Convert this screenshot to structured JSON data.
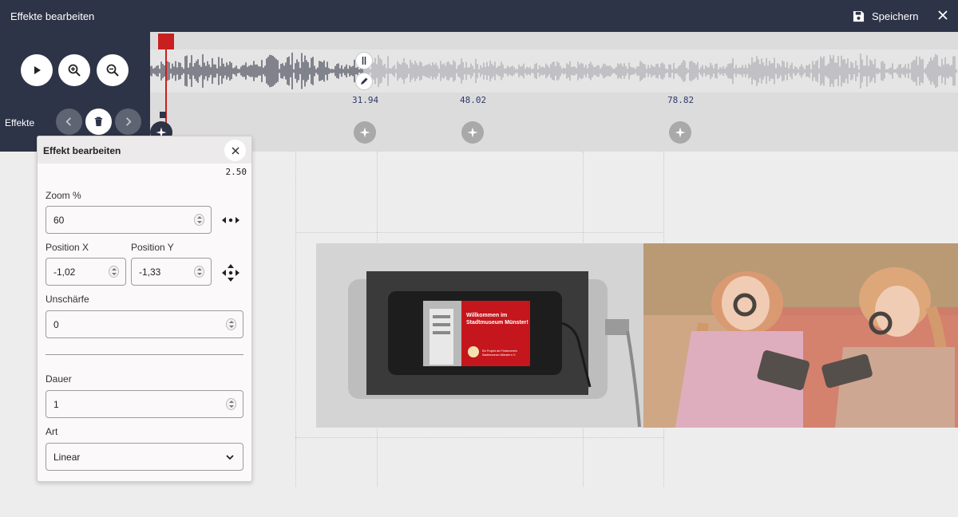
{
  "titlebar": {
    "title": "Effekte bearbeiten",
    "save_label": "Speichern",
    "save_icon": "floppy-disk-icon",
    "close_icon": "close-icon"
  },
  "controls": {
    "play_icon": "play-icon",
    "zoom_in_icon": "zoom-in-icon",
    "zoom_out_icon": "zoom-out-icon",
    "effects_label": "Effekte"
  },
  "timeline": {
    "markers": [
      {
        "time": "31.94"
      },
      {
        "time": "48.02"
      },
      {
        "time": "78.82"
      }
    ],
    "colors": {
      "playhead": "#c82020",
      "waveform_played": "#3d4150",
      "waveform_rest": "#a8a8ad"
    }
  },
  "popup": {
    "title": "Effekt bearbeiten",
    "time": "2.50",
    "zoom_label": "Zoom %",
    "zoom_value": "60",
    "posx_label": "Position X",
    "posx_value": "-1,02",
    "posy_label": "Position Y",
    "posy_value": "-1,33",
    "blur_label": "Unschärfe",
    "blur_value": "0",
    "duration_label": "Dauer",
    "duration_value": "1",
    "type_label": "Art",
    "type_value": "Linear"
  },
  "preview": {
    "screen_line1": "Willkommen im",
    "screen_line2": "Stadtmuseum Münster!",
    "screen_small1": "Ein Projekt der Förderverein",
    "screen_small2": "Stadtmuseum Münster e.V."
  }
}
